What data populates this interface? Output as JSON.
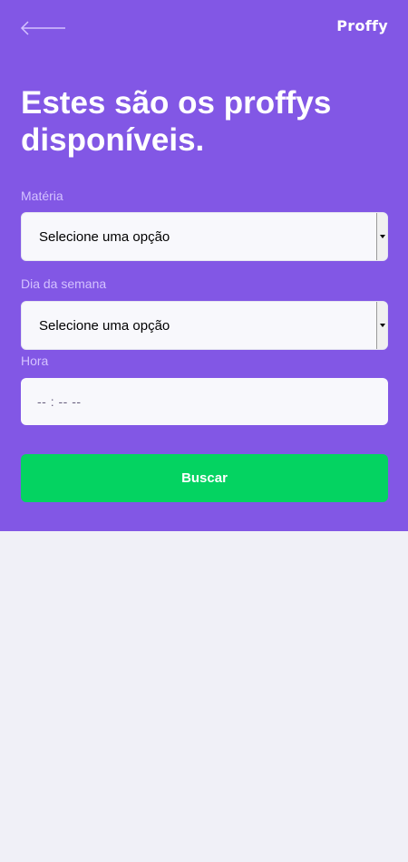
{
  "header": {
    "logo": "Proffy",
    "title": "Estes são os proffys disponíveis.",
    "back_icon": "arrow-left-icon"
  },
  "form": {
    "subject": {
      "label": "Matéria",
      "value": "Selecione uma opção"
    },
    "weekday": {
      "label": "Dia da semana",
      "value": "Selecione uma opção"
    },
    "time": {
      "label": "Hora",
      "value": "-- : --  --"
    },
    "submit_label": "Buscar"
  },
  "colors": {
    "primary": "#8257E5",
    "secondary": "#04D361",
    "background": "#F0F0F7",
    "label": "#D4C2FF"
  }
}
